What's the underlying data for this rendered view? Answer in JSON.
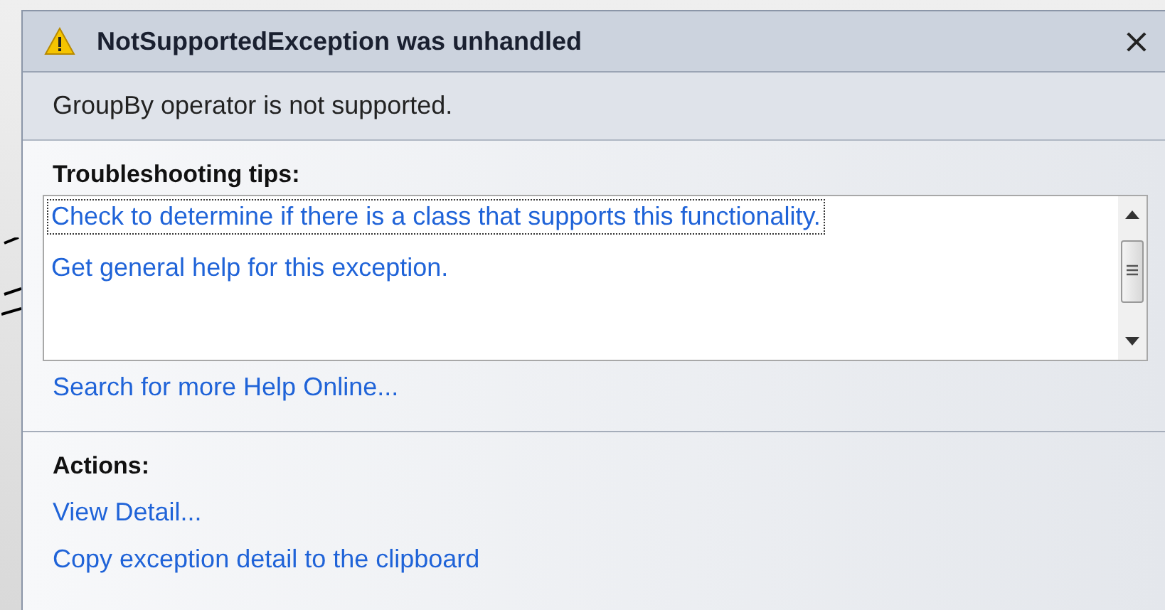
{
  "dialog": {
    "title": "NotSupportedException was unhandled",
    "close": "×",
    "message": "GroupBy operator is not supported."
  },
  "tips": {
    "heading": "Troubleshooting tips:",
    "items": [
      {
        "label": "Check to determine if there is a class that supports this functionality.",
        "selected": true
      },
      {
        "label": "Get general help for this exception.",
        "selected": false
      }
    ],
    "search_link": "Search for more Help Online..."
  },
  "actions": {
    "heading": "Actions:",
    "links": [
      "View Detail...",
      "Copy exception detail to the clipboard"
    ]
  }
}
